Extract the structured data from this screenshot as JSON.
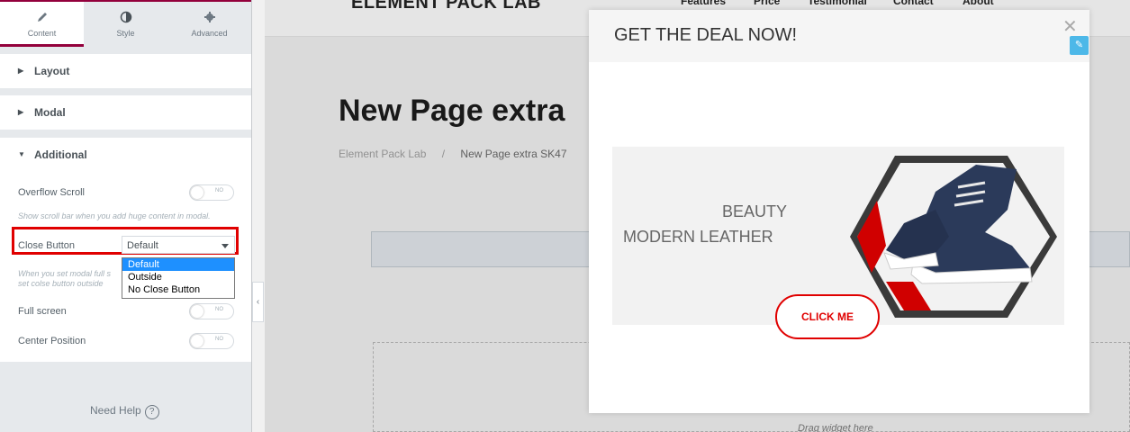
{
  "panel": {
    "tabs": [
      {
        "label": "Content",
        "icon": "pencil-icon"
      },
      {
        "label": "Style",
        "icon": "contrast-icon"
      },
      {
        "label": "Advanced",
        "icon": "gear-icon"
      }
    ],
    "sections": [
      {
        "title": "Layout",
        "icon": "caret-right-icon"
      },
      {
        "title": "Modal",
        "icon": "caret-right-icon"
      },
      {
        "title": "Additional",
        "icon": "caret-down-icon"
      }
    ],
    "overflow_scroll": {
      "label": "Overflow Scroll",
      "toggle": "NO",
      "description": "Show scroll bar when you add huge content in modal."
    },
    "close_button": {
      "label": "Close Button",
      "selected": "Default",
      "options": [
        "Default",
        "Outside",
        "No Close Button"
      ],
      "description_line1": "When you set modal full s",
      "description_line2": "set colse button outside"
    },
    "full_screen": {
      "label": "Full screen",
      "toggle": "NO"
    },
    "center_position": {
      "label": "Center Position",
      "toggle": "NO"
    },
    "help": {
      "label": "Need Help",
      "icon": "question-circle-icon"
    },
    "collapse_icon": "chevron-left-icon"
  },
  "preview": {
    "logo": "ELEMENT PACK LAB",
    "nav": [
      "Features",
      "Price",
      "Testimonial",
      "Contact",
      "About"
    ],
    "page_title": "New Page extra",
    "breadcrumb": {
      "home": "Element Pack Lab",
      "separator": "/",
      "current": "New Page extra SK47"
    },
    "drag_text": "Drag widget here"
  },
  "modal": {
    "title": "GET THE DEAL NOW!",
    "close_icon": "close-icon",
    "edit_icon": "pencil-icon",
    "banner_line1": "BEAUTY",
    "banner_line2": "MODERN LEATHER",
    "cta_label": "CLICK ME"
  },
  "colors": {
    "brand": "#93003c",
    "highlight": "#e00000",
    "cta": "#e00000",
    "select_highlight": "#1e90ff",
    "edit_badge": "#4db8e8"
  }
}
